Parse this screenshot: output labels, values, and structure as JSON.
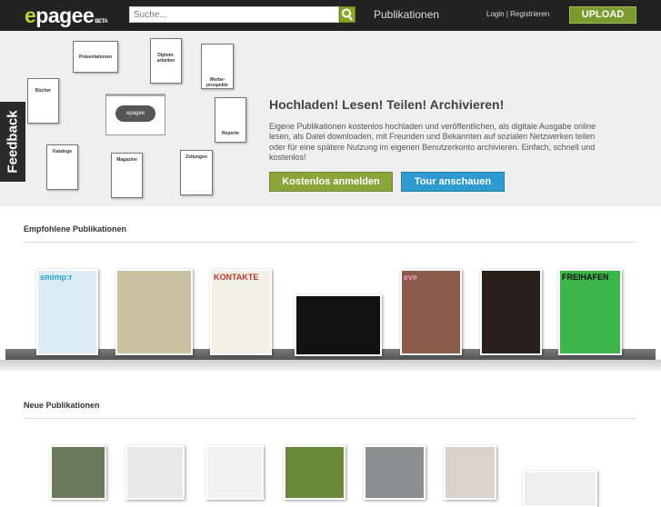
{
  "header": {
    "logo": "epagee",
    "logo_badge": "BETA",
    "search_placeholder": "Suche...",
    "nav_publications": "Publikationen",
    "login": "Login",
    "separator": "|",
    "register": "Registrieren",
    "upload": "UPLOAD"
  },
  "feedback": "Feedback",
  "hero": {
    "title": "Hochladen! Lesen! Teilen! Archivieren!",
    "text": "Eigene Publikationen kostenlos hochladen und veröffentlichen, als digitale Ausgabe online lesen, als Datei downloaden, mit Freunden und Bekannten auf sozialen Netzwerken teilen oder für eine spätere Nutzung im eigenen Benutzerkonto archivieren. Einfach, schnell und kostenlos!",
    "signup": "Kostenlos anmelden",
    "tour": "Tour anschauen",
    "diagram": {
      "center": "epagee",
      "items": [
        "Präsentationen",
        "Diplom-arbeiten",
        "Werbe-prospekte",
        "Bücher",
        "Reporte",
        "Kataloge",
        "Magazine",
        "Zeitungen"
      ]
    }
  },
  "featured": {
    "title": "Empfohlene Publikationen",
    "covers": [
      {
        "title": "smimp:r",
        "color": "#dcebf4",
        "fg": "#2aa0d0"
      },
      {
        "title": "",
        "color": "#c9c1a0",
        "fg": "#333"
      },
      {
        "title": "KONTAKTE",
        "color": "#f3f0e8",
        "fg": "#c0392b"
      },
      {
        "title": "",
        "color": "#111",
        "fg": "#e08a2a"
      },
      {
        "title": "eve",
        "color": "#8a5a4a",
        "fg": "#f39bb5"
      },
      {
        "title": "",
        "color": "#2a1f1a",
        "fg": "#ccc"
      },
      {
        "title": "FREIHAFEN",
        "color": "#3cb54a",
        "fg": "#111"
      }
    ]
  },
  "new": {
    "title": "Neue Publikationen",
    "covers": [
      {
        "color": "#6b7a5a"
      },
      {
        "color": "#e8e8e8"
      },
      {
        "color": "#f2f2f2"
      },
      {
        "color": "#6a8a3a"
      },
      {
        "color": "#8a8f90"
      },
      {
        "color": "#d8d4cc"
      },
      {
        "color": "#eeeeee"
      }
    ]
  }
}
